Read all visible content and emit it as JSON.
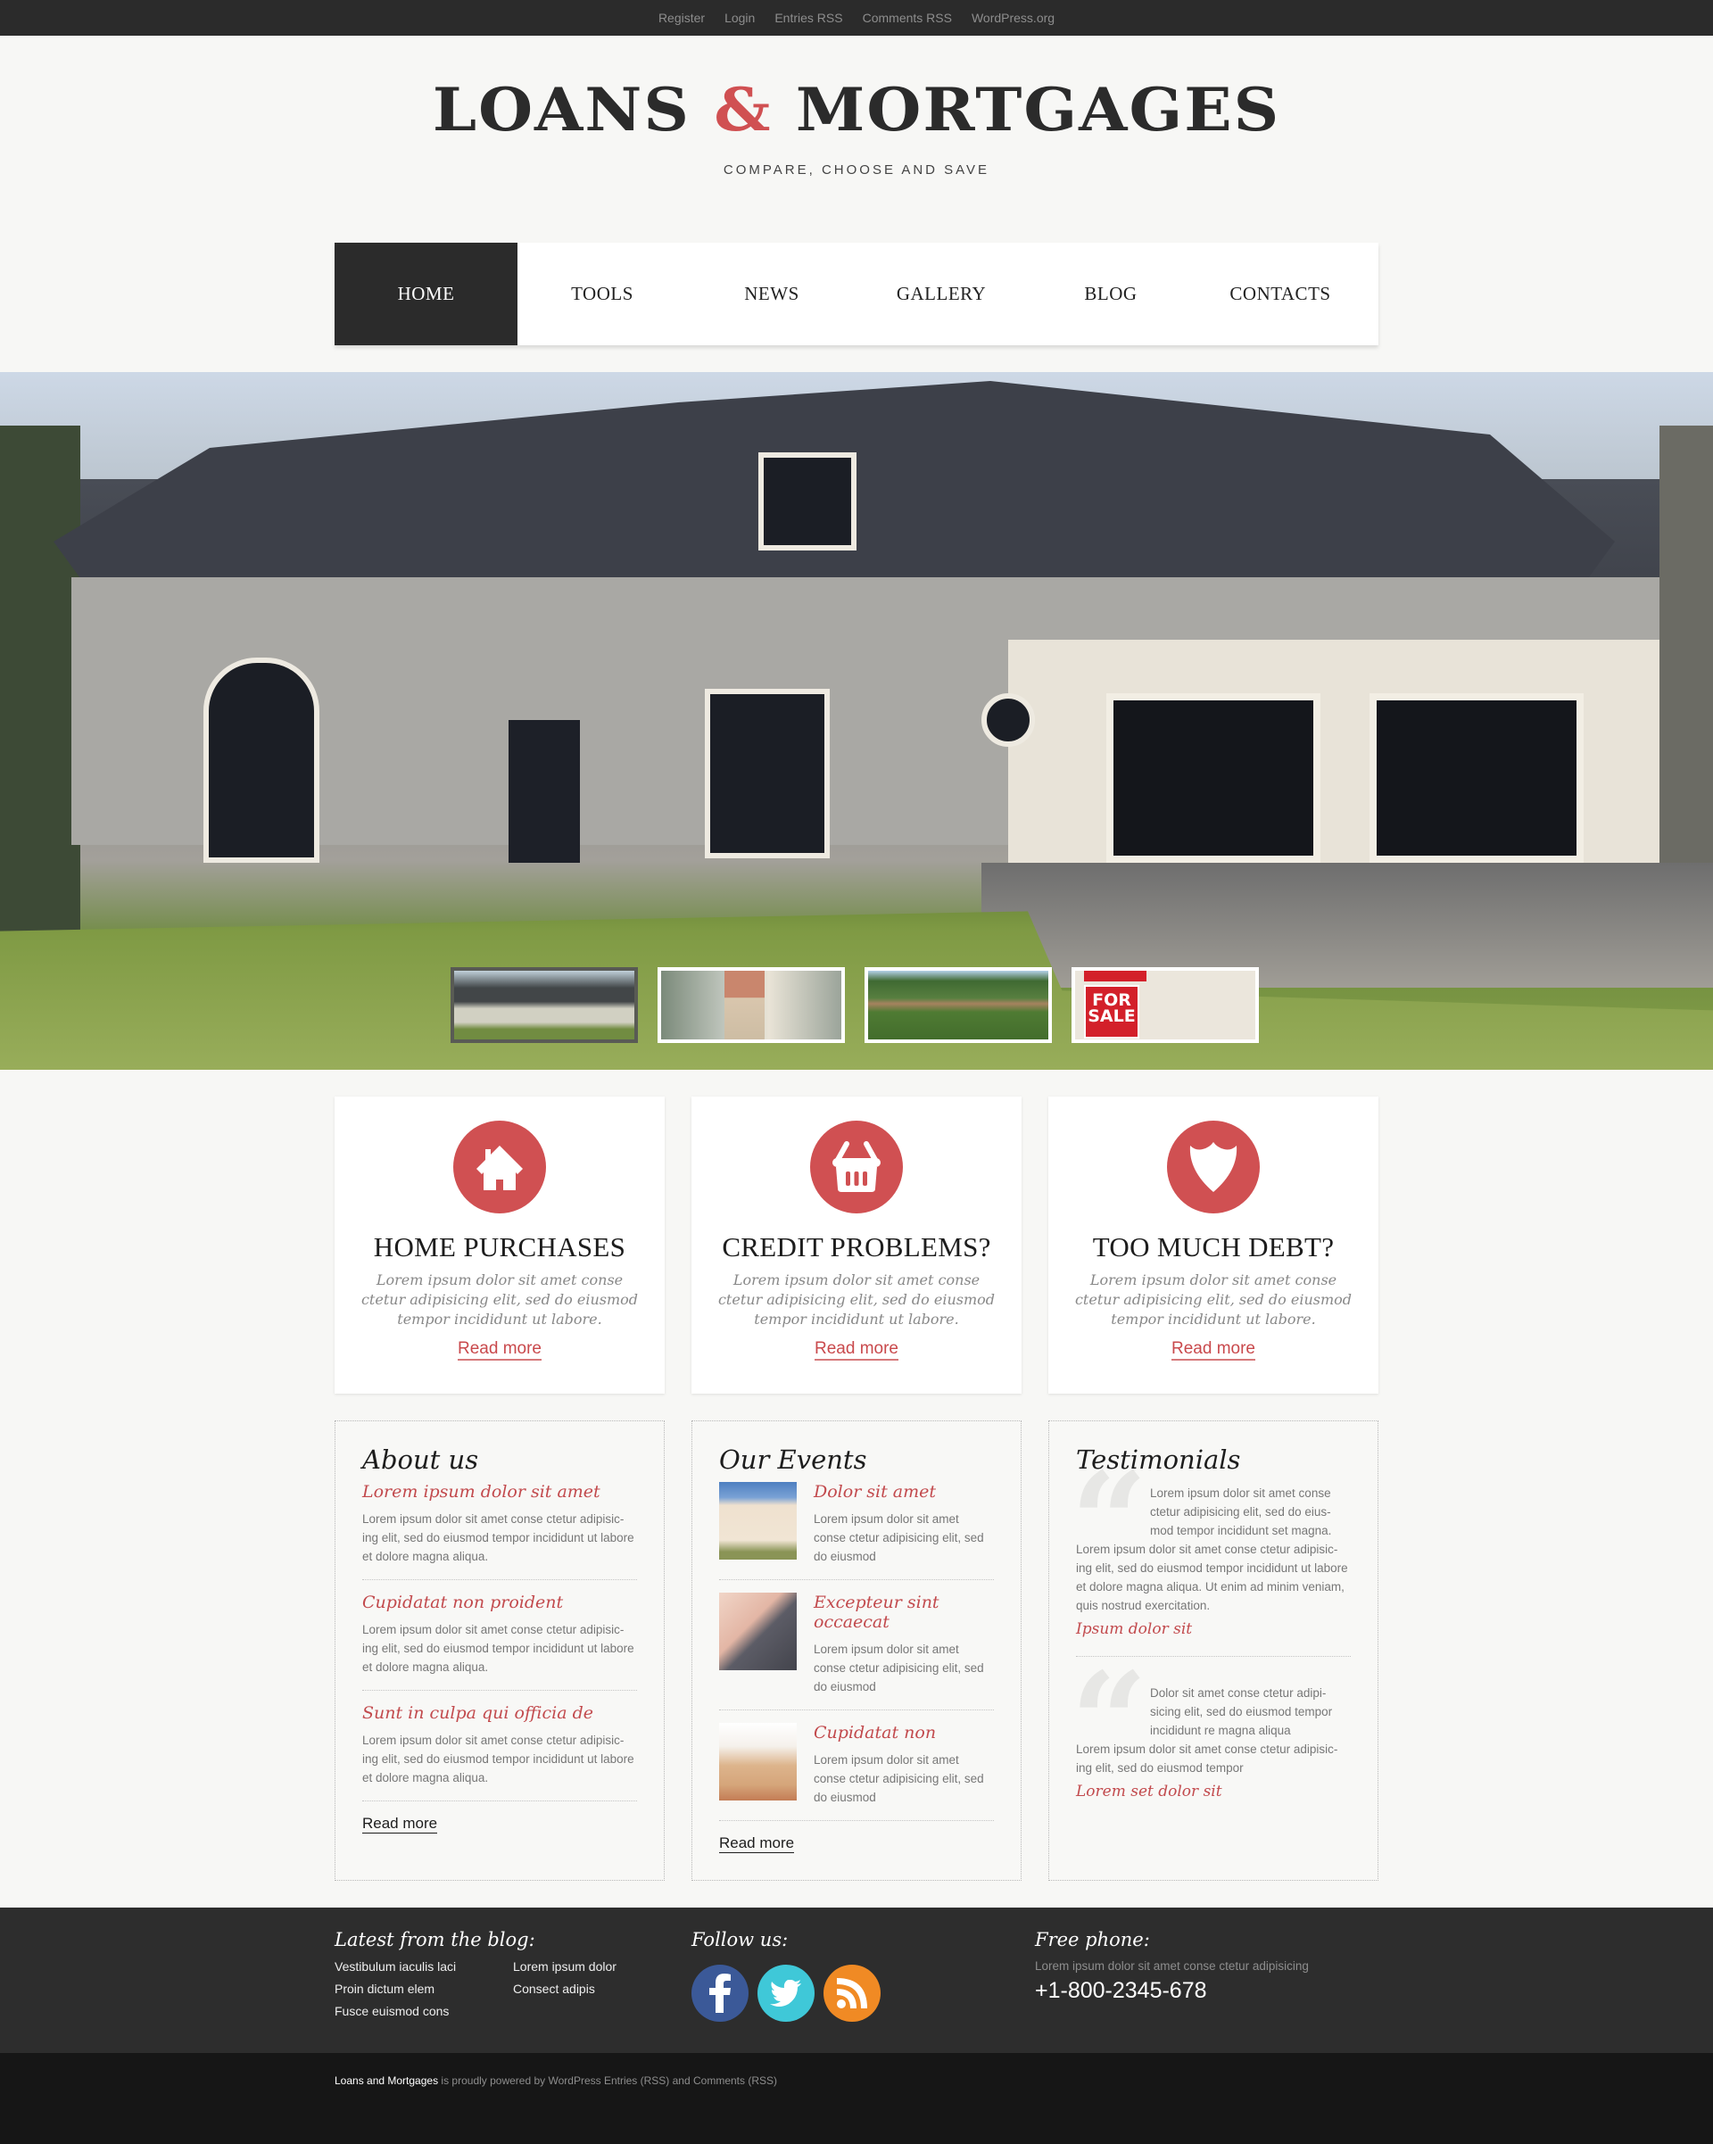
{
  "topbar": {
    "links": [
      "Register",
      "Login",
      "Entries RSS",
      "Comments RSS",
      "WordPress.org"
    ]
  },
  "header": {
    "logo_part1": "LOANS ",
    "logo_amp": "&",
    "logo_part2": " MORTGAGES",
    "tagline": "COMPARE, CHOOSE AND SAVE"
  },
  "nav": {
    "items": [
      "HOME",
      "TOOLS",
      "NEWS",
      "GALLERY",
      "BLOG",
      "CONTACTS"
    ],
    "active": "HOME"
  },
  "slider": {
    "thumbnails": [
      "house-exterior",
      "keys-in-hand",
      "house-with-trees",
      "for-sale-sign"
    ],
    "sale_sign": "FOR SALE",
    "active_index": 0
  },
  "features": [
    {
      "icon": "house-icon",
      "title": "HOME PURCHASES",
      "text": "Lorem ipsum dolor sit amet conse ctetur adipisicing elit, sed do eiusmod tempor incididunt ut labore.",
      "link": "Read more"
    },
    {
      "icon": "basket-icon",
      "title": "CREDIT PROBLEMS?",
      "text": "Lorem ipsum dolor sit amet conse ctetur adipisicing elit, sed do eiusmod tempor incididunt ut labore.",
      "link": "Read more"
    },
    {
      "icon": "shield-icon",
      "title": "TOO MUCH DEBT?",
      "text": "Lorem ipsum dolor sit amet conse ctetur adipisicing elit, sed do eiusmod tempor incididunt ut labore.",
      "link": "Read more"
    }
  ],
  "about": {
    "title": "About us",
    "entries": [
      {
        "title": "Lorem ipsum dolor sit amet",
        "text": "Lorem ipsum dolor sit amet conse ctetur adipisic-ing elit, sed do eiusmod tempor incididunt ut labore et dolore magna aliqua."
      },
      {
        "title": "Cupidatat non proident",
        "text": "Lorem ipsum dolor sit amet conse ctetur adipisic-ing elit, sed do eiusmod tempor incididunt ut labore et dolore magna aliqua."
      },
      {
        "title": "Sunt in culpa qui officia de",
        "text": "Lorem ipsum dolor sit amet conse ctetur adipisic-ing elit, sed do eiusmod tempor incididunt ut labore et dolore magna aliqua."
      }
    ],
    "more": "Read more"
  },
  "events": {
    "title": "Our Events",
    "entries": [
      {
        "title": "Dolor sit amet",
        "text": "Lorem ipsum dolor sit amet conse ctetur adipisicing elit, sed do eiusmod"
      },
      {
        "title": "Excepteur sint occaecat",
        "text": "Lorem ipsum dolor sit amet conse ctetur adipisicing elit, sed do eiusmod"
      },
      {
        "title": "Cupidatat non",
        "text": "Lorem ipsum dolor sit amet conse ctetur adipisicing elit, sed do eiusmod"
      }
    ],
    "more": "Read more"
  },
  "testimonials": {
    "title": "Testimonials",
    "entries": [
      {
        "lead": "Lorem ipsum dolor sit amet conse ctetur adipisicing elit, sed do eius-mod tempor incididunt set magna.",
        "text": "Lorem ipsum dolor sit amet conse ctetur adipisic-ing elit, sed do eiusmod tempor incididunt ut labore et dolore magna aliqua. Ut enim ad minim veniam, quis nostrud exercitation.",
        "author": "Ipsum dolor sit"
      },
      {
        "lead": "Dolor sit amet conse ctetur adipi-sicing elit, sed do eiusmod tempor incididunt  re magna aliqua",
        "text": "Lorem ipsum dolor sit amet conse ctetur adipisic-ing elit, sed do eiusmod tempor",
        "author": "Lorem set dolor sit"
      }
    ]
  },
  "footer": {
    "blog_title": "Latest from the blog:",
    "blog_links": [
      "Vestibulum iaculis laci",
      "Lorem ipsum dolor",
      "Proin dictum elem",
      "Consect adipis",
      "Fusce euismod cons"
    ],
    "follow_title": "Follow us:",
    "social": [
      "facebook",
      "twitter",
      "rss"
    ],
    "phone_title": "Free phone:",
    "phone_text": "Lorem ipsum dolor sit amet conse ctetur adipisicing",
    "phone_number": "+1-800-2345-678"
  },
  "bottom": {
    "brand": "Loans and Mortgages",
    "text": " is proudly powered by WordPress  Entries (RSS) and Comments (RSS)"
  },
  "colors": {
    "accent": "#d05052",
    "dark": "#2b2b2b",
    "background": "#f7f7f5"
  }
}
